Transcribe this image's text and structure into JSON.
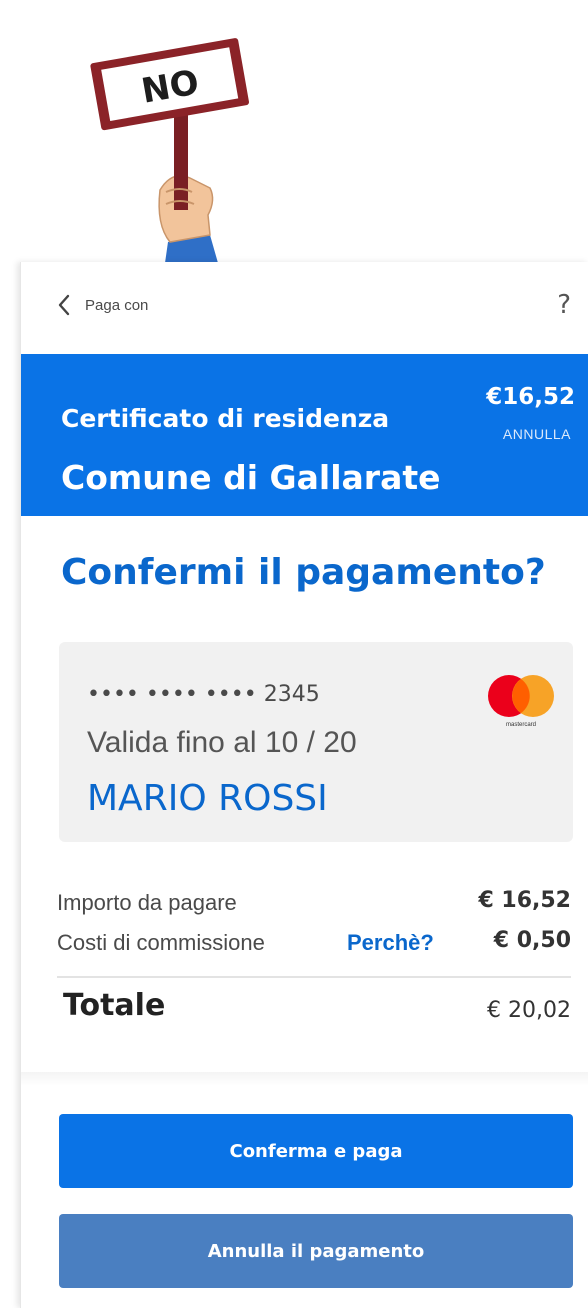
{
  "illustration": {
    "sign_text": "NO",
    "icon": "protest-sign-icon"
  },
  "topbar": {
    "back_label": "Paga con",
    "back_icon": "chevron-left-icon",
    "help_label": "?"
  },
  "header": {
    "service_name": "Certificato di residenza",
    "amount": "€16,52",
    "cancel_label": "ANNULLA",
    "comune": "Comune di Gallarate",
    "background_color": "#0a73e6"
  },
  "confirm_title": "Confermi il pagamento?",
  "card": {
    "number_masked": "•••• •••• •••• 2345",
    "expiry": "Valida fino al 10 / 20",
    "holder": "MARIO ROSSI",
    "brand_icon": "mastercard-icon",
    "brand_text": "mastercard"
  },
  "summary": {
    "amount_label": "Importo da pagare",
    "amount_value": "€ 16,52",
    "fee_label": "Costi di commissione",
    "fee_why": "Perchè?",
    "fee_value": "€ 0,50",
    "total_label": "Totale",
    "total_value": "€ 20,02"
  },
  "buttons": {
    "confirm": "Conferma e paga",
    "cancel": "Annulla il pagamento"
  }
}
